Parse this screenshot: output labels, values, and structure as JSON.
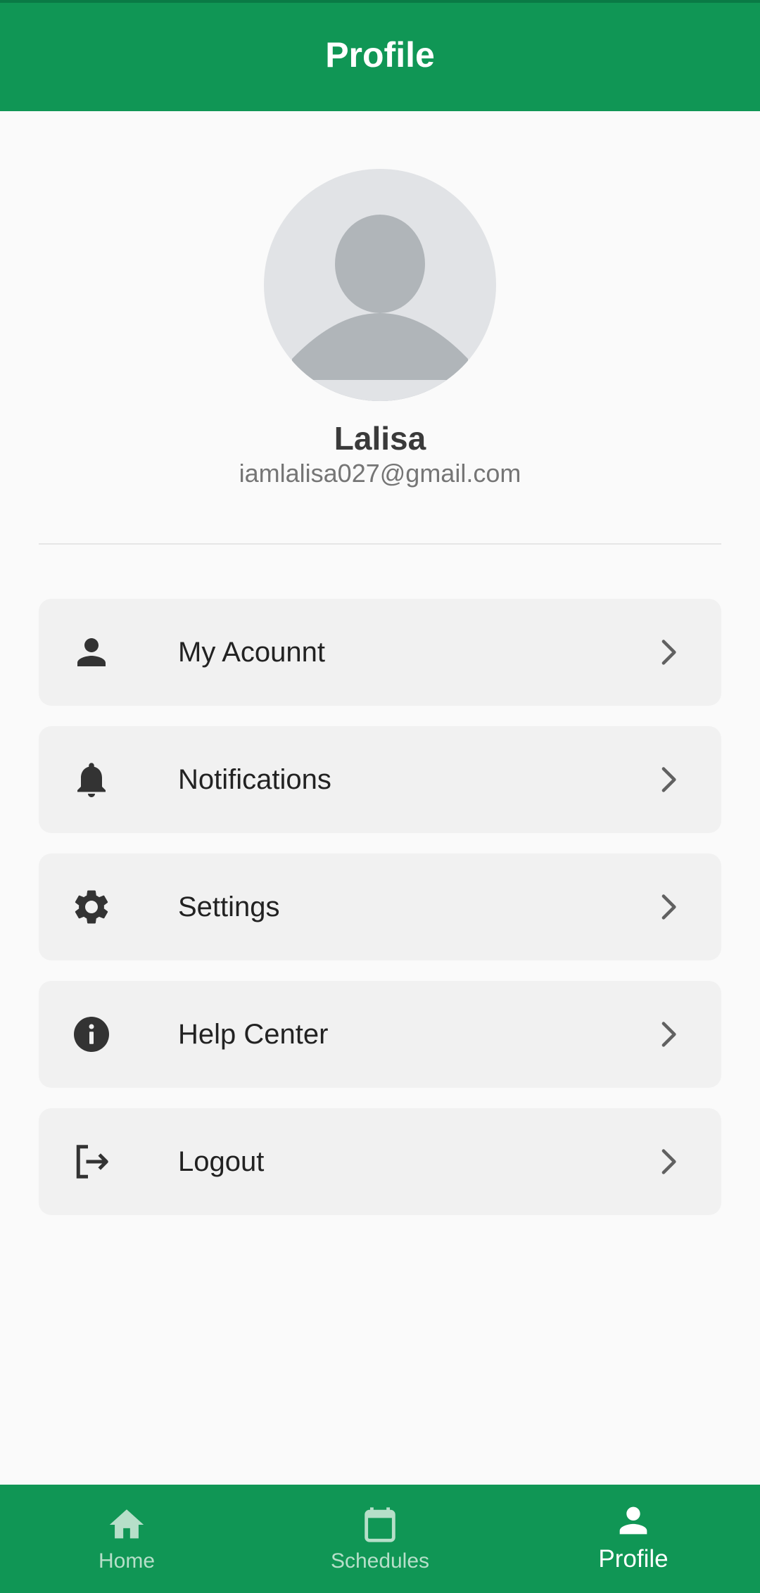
{
  "app_bar": {
    "title": "Profile"
  },
  "profile": {
    "name": "Lalisa",
    "email": "iamlalisa027@gmail.com",
    "avatar_icon": "person-placeholder-icon"
  },
  "menu": {
    "items": [
      {
        "label": "My Acounnt",
        "icon": "person-icon"
      },
      {
        "label": "Notifications",
        "icon": "bell-icon"
      },
      {
        "label": "Settings",
        "icon": "gear-icon"
      },
      {
        "label": "Help Center",
        "icon": "info-icon"
      },
      {
        "label": "Logout",
        "icon": "logout-icon"
      }
    ]
  },
  "bottom_nav": {
    "items": [
      {
        "label": "Home",
        "icon": "home-icon",
        "active": false
      },
      {
        "label": "Schedules",
        "icon": "calendar-icon",
        "active": false
      },
      {
        "label": "Profile",
        "icon": "person-icon",
        "active": true
      }
    ]
  },
  "colors": {
    "primary": "#109655",
    "background": "#fafafa",
    "card": "#f1f1f1",
    "nav_inactive": "#b6dfc9"
  }
}
